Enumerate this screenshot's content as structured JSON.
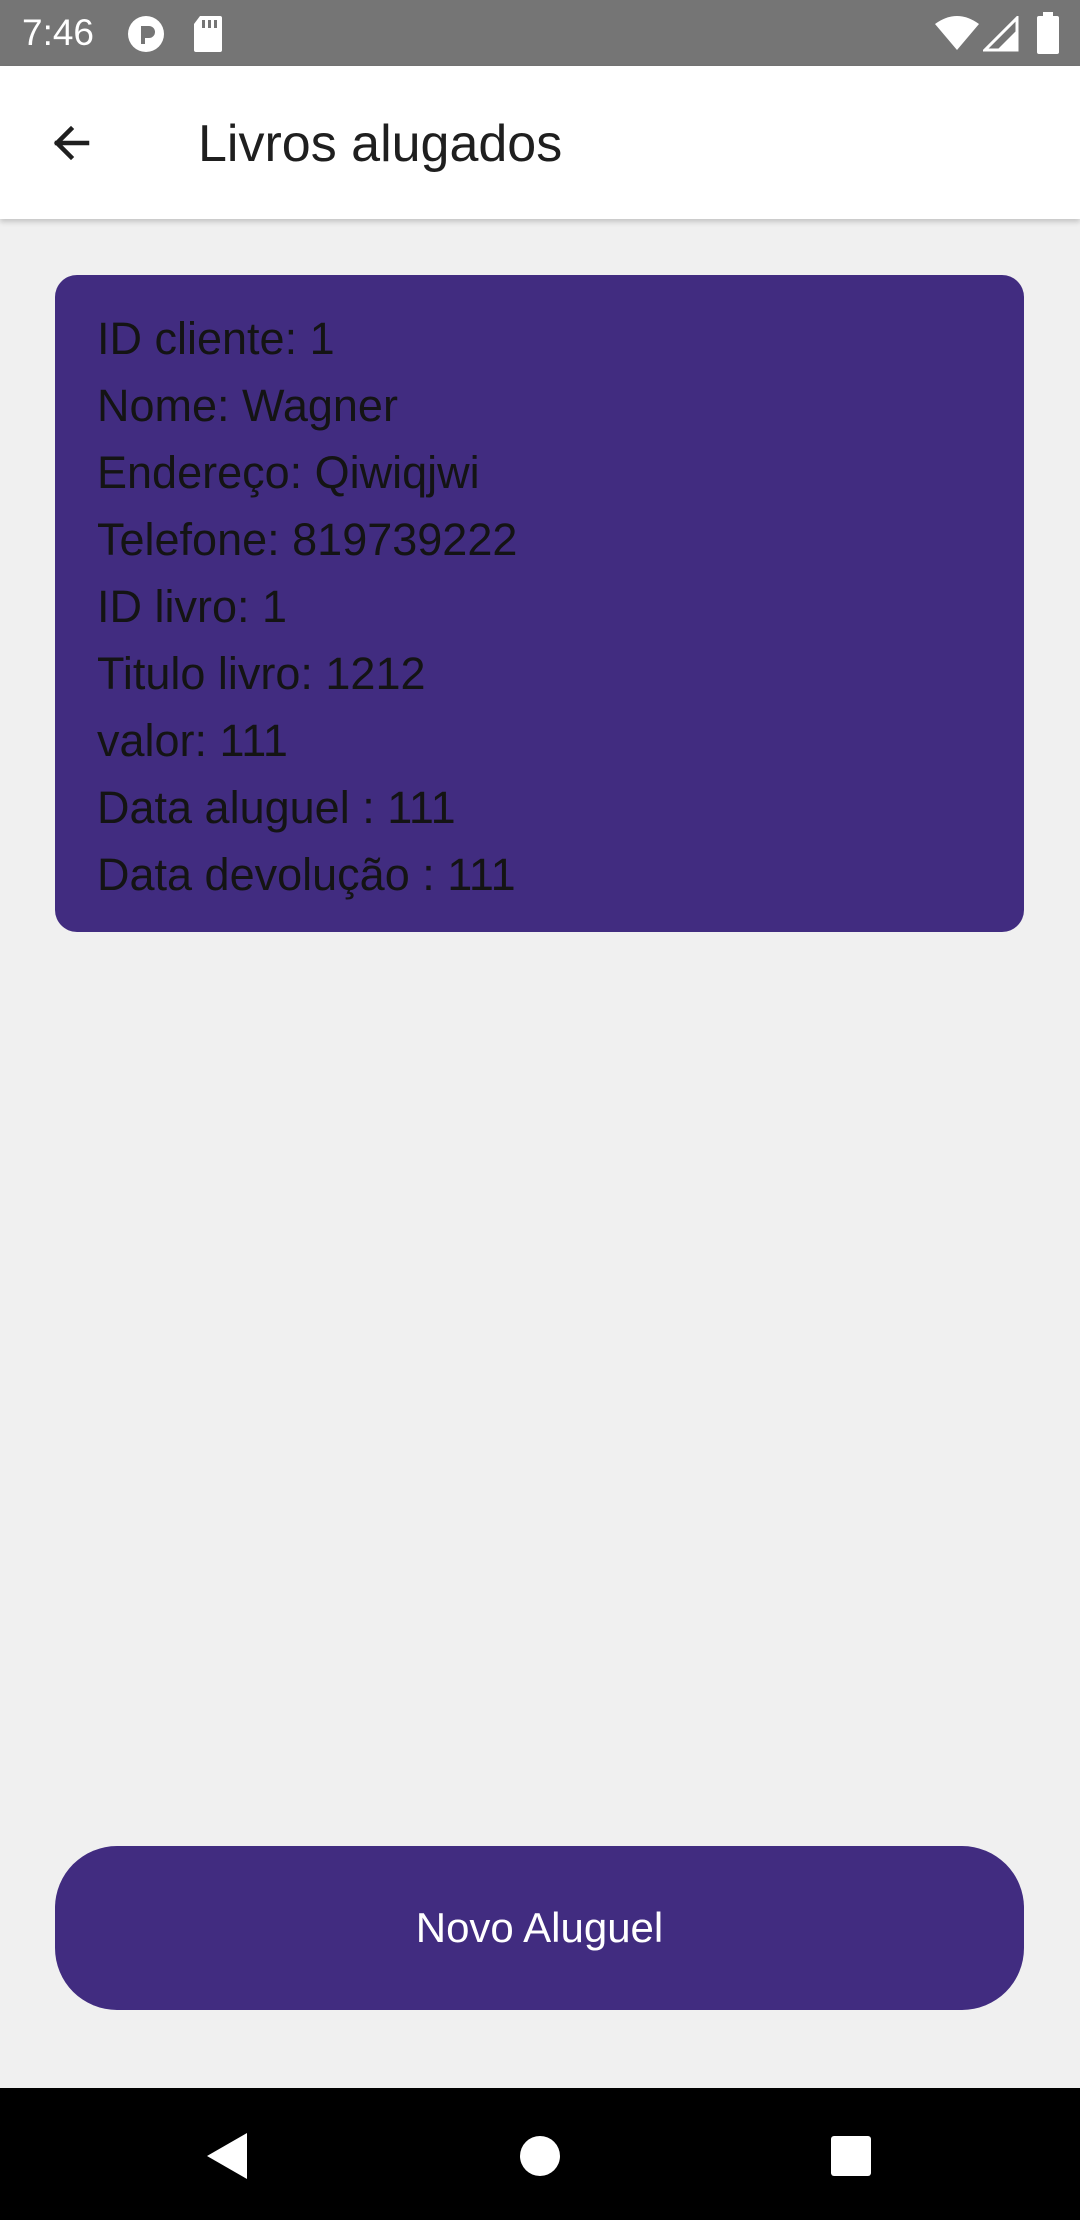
{
  "status_bar": {
    "time": "7:46",
    "icons": [
      "notification-icon",
      "sd-card-icon",
      "wifi-icon",
      "signal-icon",
      "battery-icon"
    ]
  },
  "app_bar": {
    "title": "Livros alugados",
    "back_icon": "arrow-back-icon"
  },
  "rental_card": {
    "lines": [
      "ID cliente: 1",
      "Nome: Wagner",
      "Endereço: Qiwiqjwi",
      "Telefone: 819739222",
      "ID livro: 1",
      "Titulo livro: 1212",
      "valor: 111",
      "Data aluguel : 111",
      "Data devolução : 111"
    ]
  },
  "actions": {
    "new_rental_label": "Novo Aluguel"
  },
  "nav_bar": {
    "icons": [
      "back-triangle-icon",
      "home-circle-icon",
      "recents-square-icon"
    ]
  },
  "colors": {
    "primary": "#412c80",
    "background": "#f0f0f0",
    "status_bar": "#757575"
  }
}
